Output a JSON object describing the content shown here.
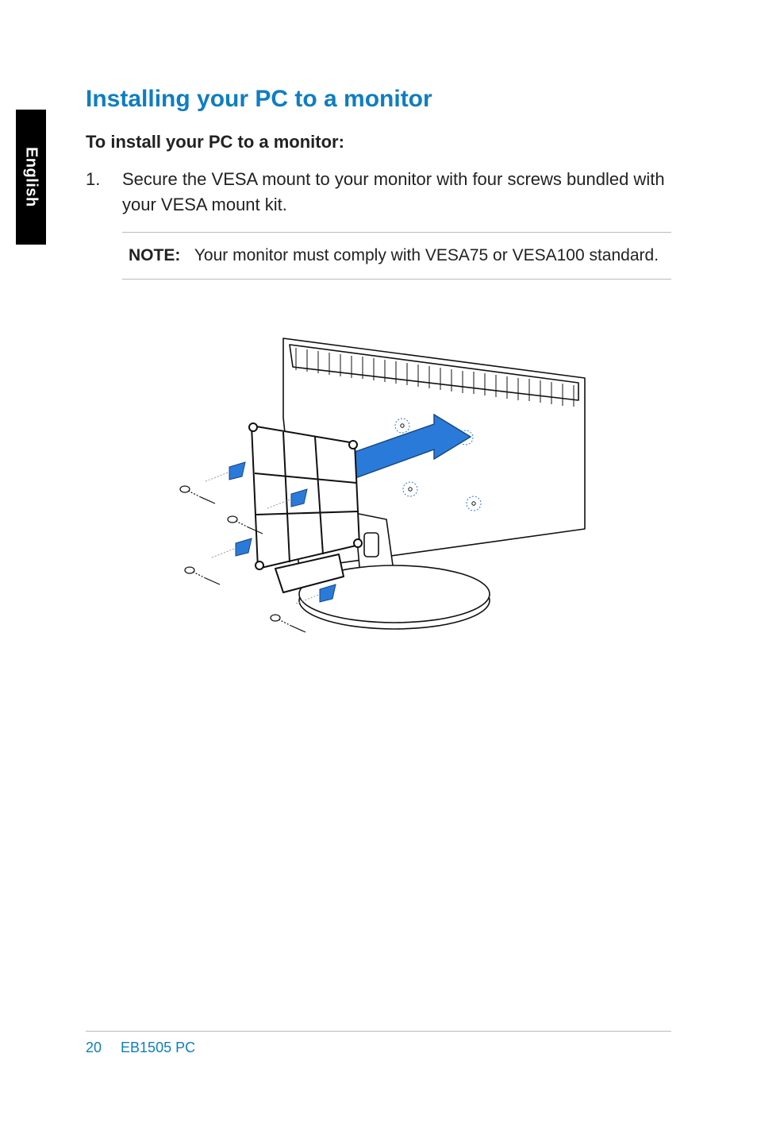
{
  "language_tab": "English",
  "heading": "Installing your PC to a monitor",
  "subheading": "To install your PC to a monitor:",
  "steps": [
    {
      "number": "1.",
      "text": "Secure the VESA mount to your monitor with four screws bundled with your VESA mount kit."
    }
  ],
  "note": {
    "label": "NOTE:",
    "text": "Your monitor must comply with VESA75 or VESA100 standard."
  },
  "figure_alt": "Diagram of a VESA mount bracket being attached with four screws to the back of a monitor on a stand",
  "footer": {
    "page_number": "20",
    "model": "EB1505 PC"
  },
  "colors": {
    "accent": "#0f7dc2",
    "arrow": "#2a7bd9",
    "screw_arrow": "#2a7bd9"
  }
}
